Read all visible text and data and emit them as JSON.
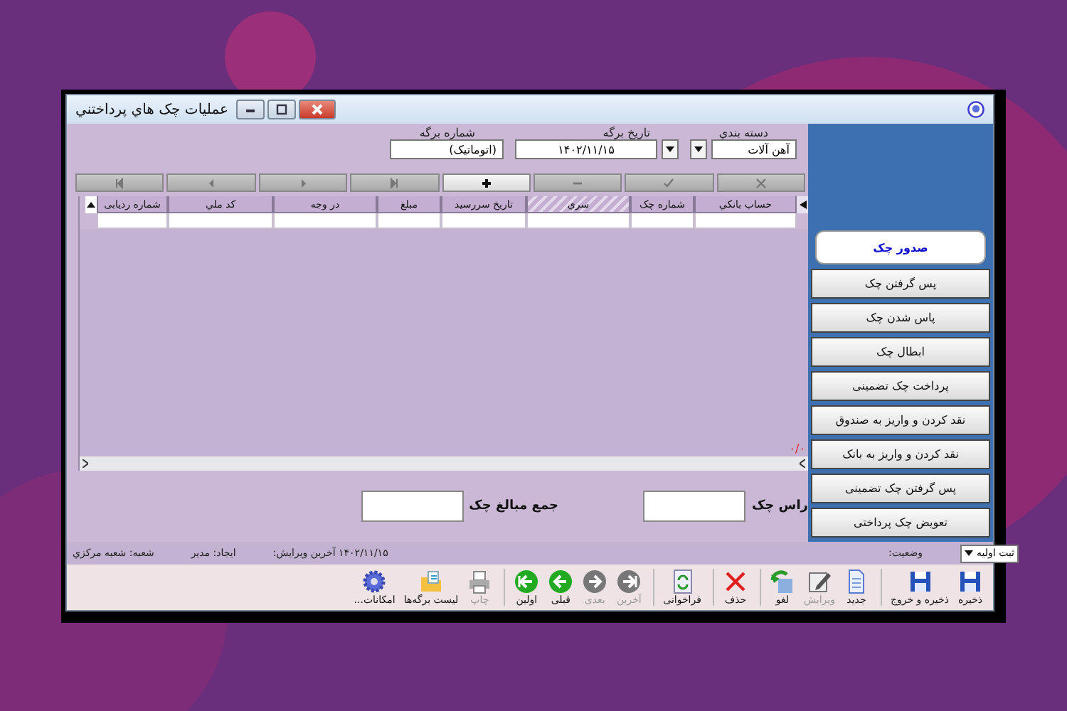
{
  "window": {
    "title": "عمليات چک هاي پرداختني"
  },
  "sidebar": {
    "items": [
      {
        "label": "صدور چک",
        "selected": true
      },
      {
        "label": "پس گرفتن چک",
        "selected": false
      },
      {
        "label": "پاس شدن چک",
        "selected": false
      },
      {
        "label": "ابطال چک",
        "selected": false
      },
      {
        "label": "پرداخت چک تضمینی",
        "selected": false
      },
      {
        "label": "نقد کردن و واریز به صندوق",
        "selected": false
      },
      {
        "label": "نقد کردن و واریز به بانک",
        "selected": false
      },
      {
        "label": "پس گرفتن چک تضمینی",
        "selected": false
      },
      {
        "label": "تعویض چک پرداختی",
        "selected": false
      }
    ]
  },
  "header": {
    "fields": [
      {
        "label": "دسته بندي",
        "value": "آهن آلات",
        "kind": "dropdown"
      },
      {
        "label": "تاریخ برگه",
        "value": "۱۴۰۲/۱۱/۱۵",
        "kind": "date"
      },
      {
        "label": "شماره برگه",
        "value": "(اتوماتیک)",
        "kind": "text"
      }
    ]
  },
  "nav_buttons": [
    {
      "kind": "cancel",
      "disabled": true
    },
    {
      "kind": "confirm",
      "disabled": true
    },
    {
      "kind": "remove",
      "disabled": true
    },
    {
      "kind": "add",
      "disabled": false
    },
    {
      "kind": "last",
      "disabled": true
    },
    {
      "kind": "next",
      "disabled": true
    },
    {
      "kind": "prev",
      "disabled": true
    },
    {
      "kind": "first",
      "disabled": true
    }
  ],
  "table": {
    "columns": [
      {
        "label": "حساب بانکي",
        "highlighted": false
      },
      {
        "label": "شماره چک",
        "highlighted": false
      },
      {
        "label": "سري",
        "highlighted": true
      },
      {
        "label": "تاریخ سررسید",
        "highlighted": false
      },
      {
        "label": "مبلغ",
        "highlighted": false
      },
      {
        "label": "در وجه",
        "highlighted": false
      },
      {
        "label": "کد ملي",
        "highlighted": false
      },
      {
        "label": "شماره ردیابی",
        "highlighted": false
      }
    ],
    "counter": "۰/۰"
  },
  "totals": [
    {
      "label": "راس چک"
    },
    {
      "label": "جمع مبالغ چک"
    }
  ],
  "status_bar": {
    "branch": "شعبه:  شعبه مرکزي",
    "creator": "ایجاد: مدیر",
    "edited": "۱۴۰۲/۱۱/۱۵ آخرین ویرایش:",
    "state_label": "وضعیت:",
    "state_value": "ثبت اولیه"
  },
  "toolbar": [
    {
      "label": "ذخیره",
      "kind": "save",
      "disabled": false
    },
    {
      "label": "ذخیره و خروج",
      "kind": "save",
      "disabled": false
    },
    {
      "label": "جدید",
      "kind": "new",
      "disabled": false
    },
    {
      "label": "ویرایش",
      "kind": "edit",
      "disabled": true
    },
    {
      "label": "لغو",
      "kind": "undo",
      "disabled": false
    },
    {
      "label": "حذف",
      "kind": "delete",
      "disabled": false
    },
    {
      "label": "فراخوانی",
      "kind": "refresh",
      "disabled": false
    },
    {
      "label": "آخرین",
      "kind": "last",
      "disabled": true
    },
    {
      "label": "بعدی",
      "kind": "next",
      "disabled": true
    },
    {
      "label": "قبلی",
      "kind": "prev",
      "disabled": false
    },
    {
      "label": "اولین",
      "kind": "first",
      "disabled": false
    },
    {
      "label": "چاپ",
      "kind": "print",
      "disabled": true
    },
    {
      "label": "لیست برگه‌ها",
      "kind": "folder",
      "disabled": false
    },
    {
      "label": "امکانات...",
      "kind": "gear",
      "disabled": false
    }
  ]
}
